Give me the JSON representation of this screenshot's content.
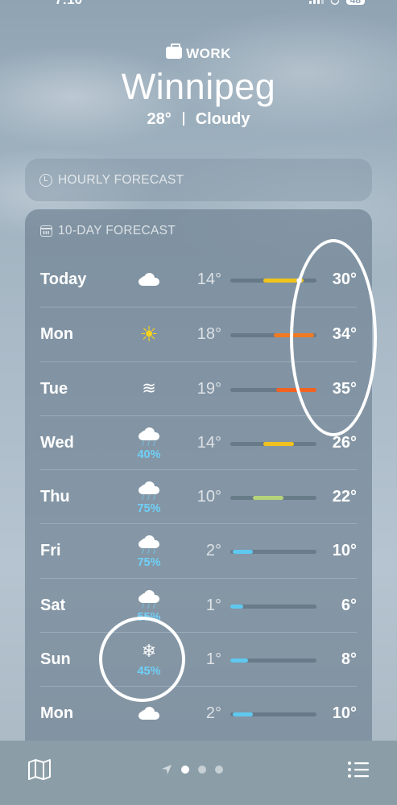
{
  "status": {
    "time": "7:10",
    "battery": "48"
  },
  "location": {
    "tag": "WORK",
    "city": "Winnipeg",
    "temp": "28°",
    "condition": "Cloudy"
  },
  "hourly": {
    "label": "HOURLY FORECAST"
  },
  "daily": {
    "label": "10-DAY FORECAST",
    "range": {
      "min": 1,
      "max": 35
    },
    "days": [
      {
        "day": "Today",
        "icon": "cloud-icon",
        "precip": "",
        "low": "14°",
        "high": "30°",
        "lowVal": 14,
        "highVal": 30,
        "color": "#f0c419",
        "current": 28
      },
      {
        "day": "Mon",
        "icon": "sun-icon",
        "precip": "",
        "low": "18°",
        "high": "34°",
        "lowVal": 18,
        "highVal": 34,
        "color": "#f07a21"
      },
      {
        "day": "Tue",
        "icon": "wind-icon",
        "precip": "",
        "low": "19°",
        "high": "35°",
        "lowVal": 19,
        "highVal": 35,
        "color": "#f26322"
      },
      {
        "day": "Wed",
        "icon": "cloud-rain-icon",
        "precip": "40%",
        "low": "14°",
        "high": "26°",
        "lowVal": 14,
        "highVal": 26,
        "color": "#f1c21f"
      },
      {
        "day": "Thu",
        "icon": "cloud-rain-icon",
        "precip": "75%",
        "low": "10°",
        "high": "22°",
        "lowVal": 10,
        "highVal": 22,
        "color": "#b5d37a"
      },
      {
        "day": "Fri",
        "icon": "cloud-rain-icon",
        "precip": "75%",
        "low": "2°",
        "high": "10°",
        "lowVal": 2,
        "highVal": 10,
        "color": "#5fc8ef"
      },
      {
        "day": "Sat",
        "icon": "cloud-rain-icon",
        "precip": "55%",
        "low": "1°",
        "high": "6°",
        "lowVal": 1,
        "highVal": 6,
        "color": "#5fc8ef"
      },
      {
        "day": "Sun",
        "icon": "snowflake-icon",
        "precip": "45%",
        "low": "1°",
        "high": "8°",
        "lowVal": 1,
        "highVal": 8,
        "color": "#5fc8ef"
      },
      {
        "day": "Mon",
        "icon": "cloud-icon",
        "precip": "",
        "low": "2°",
        "high": "10°",
        "lowVal": 2,
        "highVal": 10,
        "color": "#5fc8ef"
      }
    ]
  },
  "icons": {
    "sun": "☀",
    "wind": "≋",
    "snow": "❄",
    "rain": "/ / /"
  }
}
